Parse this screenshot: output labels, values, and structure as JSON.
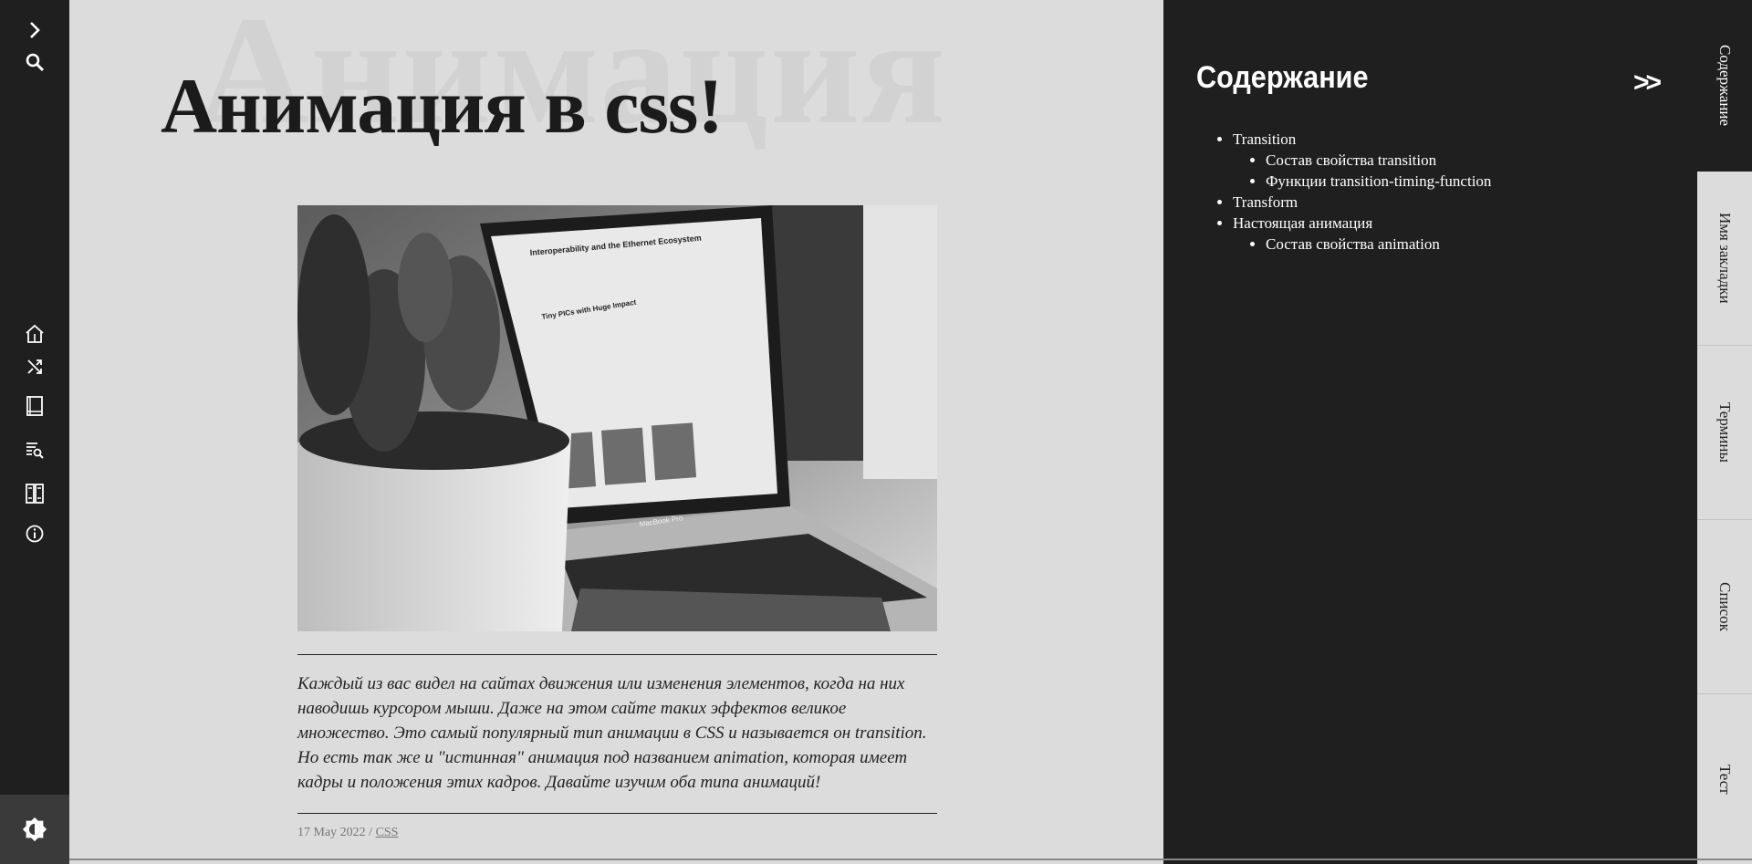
{
  "article": {
    "title": "Анимация в css!",
    "watermark": "Анимация",
    "intro": "Каждый из вас видел на сайтах движения или изменения элементов, когда на них наводишь курсором мыши. Даже на этом сайте таких эффектов великое множество. Это самый популярный тип анимации в CSS и называется он transition. Но есть так же и \"истинная\" анимация под названием animation, которая имеет кадры и положения этих кадров. Давайте изучим оба типа анимаций!",
    "date": "17 May 2022",
    "separator": " / ",
    "category": "CSS",
    "hero_screen": {
      "heading": "Interoperability and the Ethernet Ecosystem",
      "card_title": "Tiny PICs with Huge Impact",
      "laptop_label": "MacBook Pro"
    }
  },
  "sidebar": {
    "icons": [
      "expand-icon",
      "search-icon",
      "home-icon",
      "shuffle-icon",
      "book-icon",
      "search-list-icon",
      "library-icon",
      "info-icon",
      "theme-toggle-icon"
    ]
  },
  "toc": {
    "title": "Содержание",
    "collapse": ">>",
    "items": [
      {
        "label": "Transition",
        "children": [
          "Состав свойства transition",
          "Функции transition-timing-function"
        ]
      },
      {
        "label": "Transform",
        "children": []
      },
      {
        "label": "Настоящая анимация",
        "children": [
          "Состав свойства animation"
        ]
      }
    ]
  },
  "tabs": [
    "Содержание",
    "Имя закладки",
    "Термины",
    "Список",
    "Тест"
  ],
  "colors": {
    "dark": "#1f1f1f",
    "page": "#dcdcdc",
    "tab_inactive": "#dcdcdc"
  }
}
